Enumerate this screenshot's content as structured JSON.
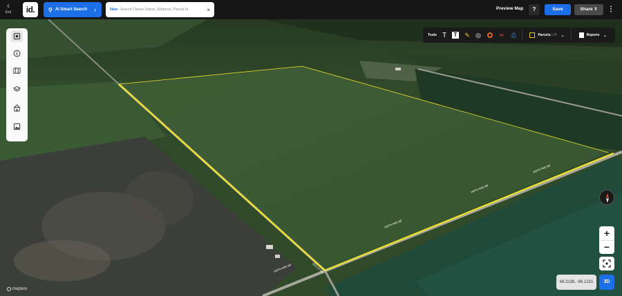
{
  "topbar": {
    "exit_label": "Exit",
    "logo_text": "id.",
    "ai_search_label": "AI Smart Search",
    "search_new_badge": "New",
    "search_placeholder": "Search Owner Name, Address, Parcel Id",
    "preview_map_label": "Preview Map",
    "help_label": "?",
    "save_label": "Save",
    "share_label": "Share"
  },
  "sidebar": {
    "items": [
      {
        "icon": "layers-panel-icon",
        "active": true
      },
      {
        "icon": "info-icon",
        "active": false
      },
      {
        "icon": "map-icon",
        "active": false
      },
      {
        "icon": "stack-layers-icon",
        "active": false
      },
      {
        "icon": "building-icon",
        "active": false
      },
      {
        "icon": "image-icon",
        "active": false
      }
    ]
  },
  "toolbar": {
    "tools_label": "Tools",
    "parcels_label": "Parcels:",
    "parcels_value": "Off",
    "reports_label": "Reports"
  },
  "map": {
    "road_labels": [
      "160TH AVE NE",
      "160TH AVE NE",
      "160TH AVE NE",
      "160TH AVE NE",
      "9TH ST NE"
    ],
    "coordinates": "48.3136, -96.1331",
    "three_d_label": "3D",
    "attribution": "mapbox"
  },
  "colors": {
    "accent": "#1d6fe8",
    "parcel_line": "#f2e22a",
    "topbar_bg": "#161616"
  }
}
